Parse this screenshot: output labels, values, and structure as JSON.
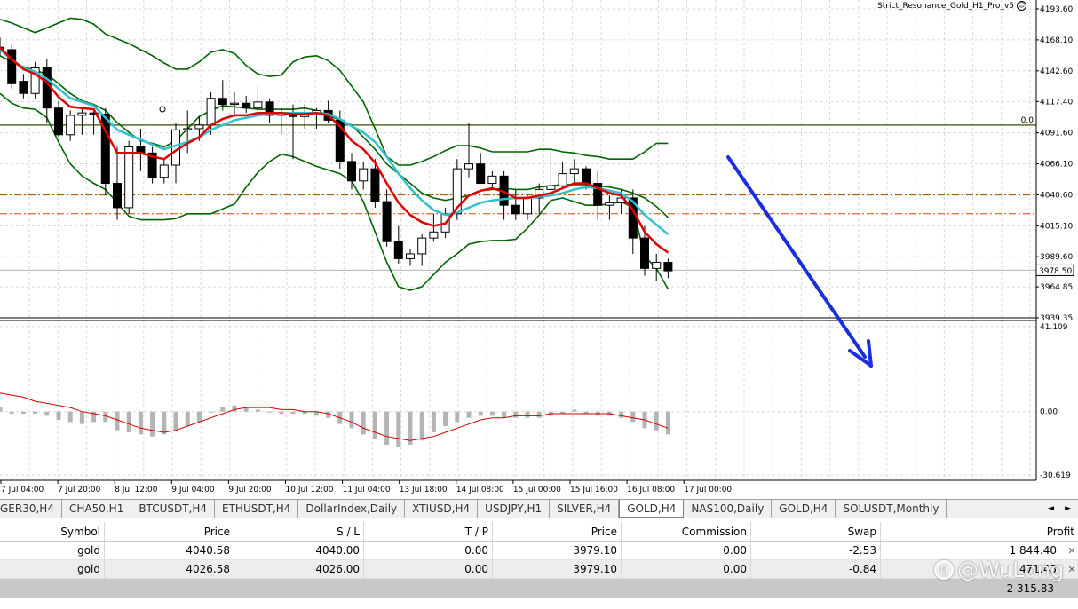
{
  "expert_label": "Strict_Resonance_Gold_H1_Pro_v5",
  "current_price": "3978.50",
  "price_levels_text": [
    "4193.60",
    "4168.10",
    "4142.60",
    "4117.40",
    "4091.60",
    "4066.10",
    "4040.60",
    "4015.10",
    "3989.60",
    "3964.85",
    "3939.35"
  ],
  "hline_label": "0.0",
  "oscillator_levels_text": [
    "41.109",
    "0.00",
    "-30.619"
  ],
  "time_labels": [
    "7 Jul 04:00",
    "7 Jul 20:00",
    "8 Jul 12:00",
    "9 Jul 04:00",
    "9 Jul 20:00",
    "10 Jul 12:00",
    "11 Jul 04:00",
    "13 Jul 18:00",
    "14 Jul 08:00",
    "15 Jul 00:00",
    "15 Jul 16:00",
    "16 Jul 08:00",
    "17 Jul 00:00"
  ],
  "tabs": [
    "GER30,H4",
    "CHA50,H1",
    "BTCUSDT,H4",
    "ETHUSDT,H4",
    "DollarIndex,Daily",
    "XTIUSD,H4",
    "USDJPY,H1",
    "SILVER,H4",
    "GOLD,H4",
    "NAS100,Daily",
    "GOLD,H4",
    "SOLUSDT,Monthly"
  ],
  "active_tab_index": 8,
  "tab_scroll_left": "◄",
  "tab_scroll_right": "►",
  "positions": {
    "columns": [
      "Symbol",
      "Price",
      "S / L",
      "T / P",
      "Price",
      "Commission",
      "Swap",
      "Profit"
    ],
    "rows": [
      [
        "gold",
        "4040.58",
        "4040.00",
        "0.00",
        "3979.10",
        "0.00",
        "-2.53",
        "1 844.40"
      ],
      [
        "gold",
        "4026.58",
        "4026.00",
        "0.00",
        "3979.10",
        "0.00",
        "-0.84",
        "471.43"
      ]
    ],
    "total": "2 315.83"
  },
  "watermark": "@WuLong",
  "colors": {
    "bollinger": "#006400",
    "ema_fast": "#e00000",
    "ema_slow": "#30c0d0",
    "arrow": "#1a2ee0",
    "level_brown": "#a06000",
    "level_red": "#e04000",
    "hline": "#556b2f",
    "histogram": "#b4b4b4",
    "osc_line": "#d00000"
  },
  "chart_data": {
    "type": "candlestick",
    "price_range": [
      3939.35,
      4193.6
    ],
    "horizontal_levels": [
      4098.0,
      4040.6,
      4025.0,
      3978.5
    ],
    "candles": [
      [
        4162,
        4170,
        4155,
        4160
      ],
      [
        4160,
        4164,
        4128,
        4132
      ],
      [
        4134,
        4140,
        4120,
        4124
      ],
      [
        4124,
        4150,
        4120,
        4145
      ],
      [
        4145,
        4152,
        4100,
        4112
      ],
      [
        4112,
        4118,
        4088,
        4090
      ],
      [
        4090,
        4110,
        4085,
        4106
      ],
      [
        4106,
        4112,
        4090,
        4108
      ],
      [
        4108,
        4110,
        4090,
        4107
      ],
      [
        4107,
        4112,
        4040,
        4050
      ],
      [
        4050,
        4080,
        4020,
        4030
      ],
      [
        4030,
        4085,
        4025,
        4080
      ],
      [
        4080,
        4095,
        4060,
        4075
      ],
      [
        4075,
        4080,
        4050,
        4055
      ],
      [
        4055,
        4070,
        4050,
        4065
      ],
      [
        4065,
        4100,
        4050,
        4094
      ],
      [
        4094,
        4110,
        4075,
        4095
      ],
      [
        4095,
        4105,
        4085,
        4098
      ],
      [
        4098,
        4125,
        4090,
        4120
      ],
      [
        4120,
        4135,
        4110,
        4115
      ],
      [
        4115,
        4125,
        4105,
        4116
      ],
      [
        4116,
        4122,
        4108,
        4112
      ],
      [
        4112,
        4130,
        4108,
        4117
      ],
      [
        4117,
        4120,
        4100,
        4106
      ],
      [
        4106,
        4112,
        4090,
        4108
      ],
      [
        4108,
        4115,
        4070,
        4105
      ],
      [
        4105,
        4115,
        4095,
        4108
      ],
      [
        4108,
        4112,
        4095,
        4110
      ],
      [
        4110,
        4118,
        4100,
        4102
      ],
      [
        4102,
        4110,
        4062,
        4068
      ],
      [
        4068,
        4075,
        4045,
        4052
      ],
      [
        4052,
        4068,
        4045,
        4062
      ],
      [
        4062,
        4070,
        4030,
        4035
      ],
      [
        4035,
        4045,
        3998,
        4002
      ],
      [
        4002,
        4015,
        3984,
        3988
      ],
      [
        3988,
        3996,
        3982,
        3992
      ],
      [
        3992,
        4008,
        3982,
        4005
      ],
      [
        4005,
        4025,
        4002,
        4010
      ],
      [
        4010,
        4030,
        4005,
        4025
      ],
      [
        4025,
        4070,
        4020,
        4062
      ],
      [
        4062,
        4100,
        4055,
        4066
      ],
      [
        4066,
        4075,
        4050,
        4050
      ],
      [
        4050,
        4060,
        4045,
        4056
      ],
      [
        4056,
        4060,
        4020,
        4032
      ],
      [
        4032,
        4045,
        4020,
        4025
      ],
      [
        4025,
        4040,
        4020,
        4038
      ],
      [
        4038,
        4050,
        4025,
        4045
      ],
      [
        4045,
        4080,
        4040,
        4048
      ],
      [
        4048,
        4068,
        4045,
        4058
      ],
      [
        4058,
        4070,
        4050,
        4062
      ],
      [
        4062,
        4064,
        4045,
        4050
      ],
      [
        4050,
        4060,
        4020,
        4032
      ],
      [
        4032,
        4040,
        4020,
        4034
      ],
      [
        4034,
        4045,
        4025,
        4038
      ],
      [
        4038,
        4045,
        3992,
        4005
      ],
      [
        4005,
        4015,
        3974,
        3980
      ],
      [
        3980,
        3992,
        3970,
        3985
      ],
      [
        3985,
        3988,
        3972,
        3978
      ]
    ],
    "bollinger_upper": [
      4185,
      4182,
      4178,
      4174,
      4178,
      4182,
      4186,
      4185,
      4181,
      4173,
      4169,
      4165,
      4160,
      4155,
      4149,
      4144,
      4144,
      4150,
      4158,
      4160,
      4157,
      4147,
      4140,
      4138,
      4139,
      4150,
      4154,
      4155,
      4151,
      4143,
      4130,
      4117,
      4095,
      4072,
      4065,
      4065,
      4068,
      4072,
      4077,
      4081,
      4081,
      4079,
      4076,
      4076,
      4076,
      4076,
      4078,
      4078,
      4076,
      4075,
      4073,
      4072,
      4070,
      4070,
      4070,
      4076,
      4083,
      4083
    ],
    "bollinger_mid": [
      4155,
      4150,
      4146,
      4143,
      4140,
      4132,
      4124,
      4118,
      4115,
      4110,
      4100,
      4092,
      4085,
      4083,
      4080,
      4085,
      4095,
      4105,
      4110,
      4114,
      4113,
      4112,
      4111,
      4111,
      4111,
      4111,
      4112,
      4110,
      4106,
      4102,
      4098,
      4088,
      4078,
      4066,
      4058,
      4050,
      4042,
      4038,
      4036,
      4038,
      4040,
      4044,
      4045,
      4046,
      4045,
      4045,
      4047,
      4048,
      4049,
      4049,
      4049,
      4048,
      4047,
      4045,
      4042,
      4038,
      4031,
      4022
    ],
    "bollinger_lower": [
      4124,
      4116,
      4112,
      4111,
      4104,
      4084,
      4066,
      4056,
      4050,
      4045,
      4034,
      4023,
      4020,
      4020,
      4020,
      4021,
      4025,
      4025,
      4025,
      4029,
      4033,
      4047,
      4059,
      4068,
      4074,
      4072,
      4068,
      4064,
      4061,
      4058,
      4052,
      4035,
      4010,
      3985,
      3965,
      3962,
      3965,
      3975,
      3985,
      3992,
      4000,
      4002,
      4003,
      4003,
      4004,
      4013,
      4024,
      4036,
      4038,
      4035,
      4032,
      4032,
      4033,
      4035,
      4030,
      3990,
      3980,
      3963
    ],
    "ema_fast": [
      4162,
      4152,
      4144,
      4140,
      4133,
      4121,
      4113,
      4112,
      4111,
      4093,
      4075,
      4075,
      4075,
      4072,
      4070,
      4077,
      4083,
      4088,
      4098,
      4103,
      4106,
      4106,
      4108,
      4108,
      4108,
      4107,
      4107,
      4108,
      4106,
      4097,
      4085,
      4078,
      4067,
      4050,
      4034,
      4024,
      4018,
      4015,
      4017,
      4030,
      4040,
      4044,
      4046,
      4043,
      4038,
      4038,
      4040,
      4042,
      4046,
      4050,
      4050,
      4046,
      4042,
      4040,
      4028,
      4010,
      4000,
      3993
    ],
    "ema_slow": [
      4160,
      4152,
      4145,
      4142,
      4136,
      4128,
      4120,
      4117,
      4114,
      4104,
      4094,
      4090,
      4086,
      4082,
      4078,
      4081,
      4084,
      4088,
      4094,
      4098,
      4102,
      4104,
      4106,
      4107,
      4108,
      4108,
      4108,
      4108,
      4107,
      4103,
      4097,
      4092,
      4084,
      4072,
      4058,
      4046,
      4036,
      4028,
      4024,
      4026,
      4030,
      4034,
      4036,
      4037,
      4038,
      4038,
      4039,
      4040,
      4042,
      4045,
      4047,
      4046,
      4044,
      4042,
      4035,
      4024,
      4016,
      4008
    ],
    "oscillator_range": [
      -30.619,
      41.109
    ],
    "histogram": [
      2,
      -1,
      -1,
      -1,
      -2,
      -4,
      -5,
      -6,
      -5,
      -5,
      -9,
      -10,
      -11,
      -12,
      -11,
      -9,
      -7,
      -5,
      0,
      2,
      3,
      2,
      1,
      0,
      -1,
      -1,
      -1,
      -2,
      -3,
      -6,
      -8,
      -11,
      -13,
      -16,
      -17,
      -16,
      -14,
      -10,
      -7,
      -5,
      -3,
      -2,
      -2,
      -3,
      -3,
      -3,
      -3,
      -2,
      -1,
      1,
      -1,
      -2,
      -2,
      -3,
      -5,
      -8,
      -9,
      -11
    ],
    "osc_line": [
      9,
      8,
      7,
      5,
      4,
      3,
      2,
      0,
      -1,
      -2,
      -4,
      -6,
      -8,
      -9,
      -10,
      -9,
      -7,
      -5,
      -3,
      -1,
      1,
      2,
      2,
      2,
      1,
      1,
      0,
      0,
      -1,
      -3,
      -5,
      -8,
      -10,
      -12,
      -13,
      -14,
      -13,
      -12,
      -10,
      -8,
      -6,
      -4,
      -3,
      -3,
      -2,
      -2,
      -2,
      -1,
      -1,
      -1,
      -1,
      -1,
      -1,
      -2,
      -3,
      -4,
      -6,
      -8
    ]
  }
}
